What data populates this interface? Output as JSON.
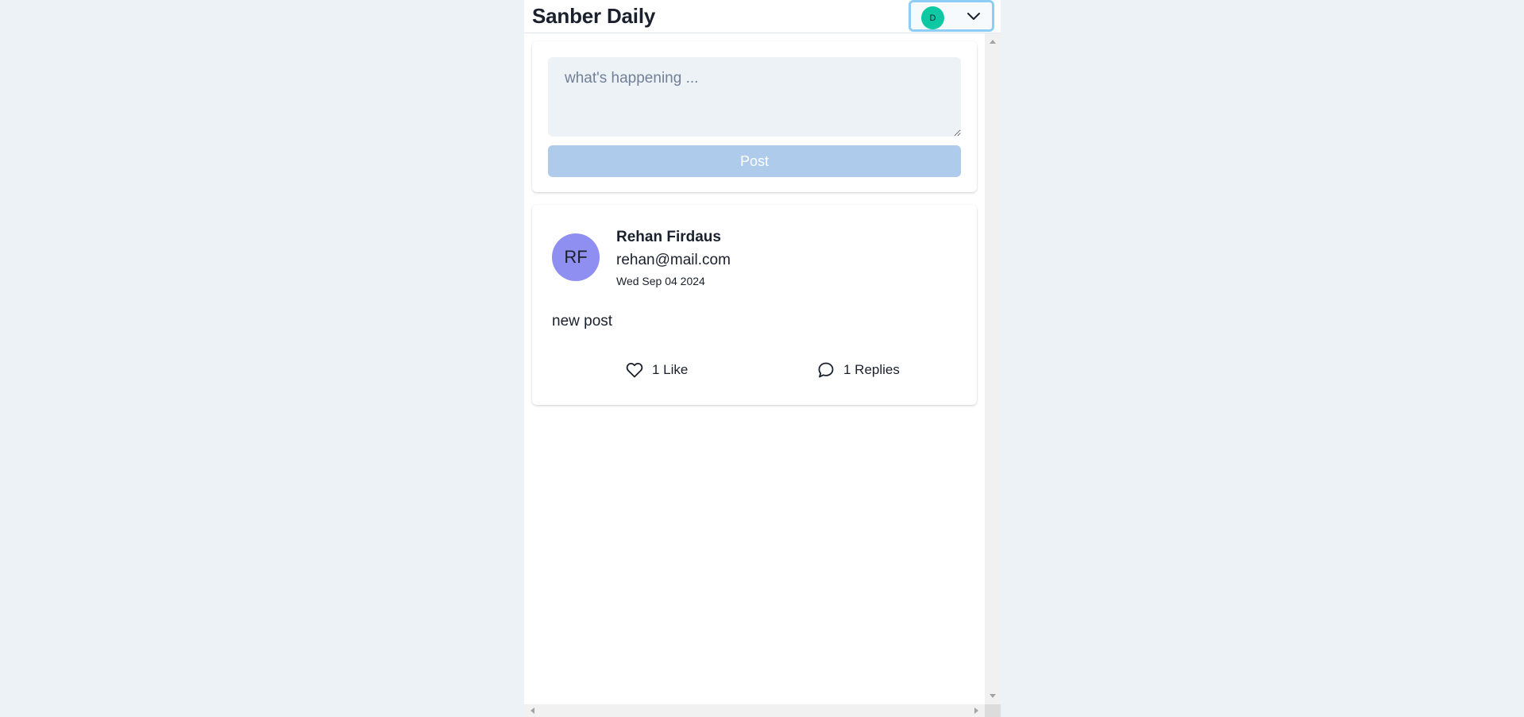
{
  "header": {
    "brand": "Sanber Daily",
    "user_initial": "D"
  },
  "composer": {
    "placeholder": "what's happening ...",
    "value": "",
    "post_label": "Post"
  },
  "post": {
    "avatar_initials": "RF",
    "author_name": "Rehan Firdaus",
    "author_email": "rehan@mail.com",
    "date": "Wed Sep 04 2024",
    "content": "new post",
    "like_label": "1 Like",
    "reply_label": "1 Replies"
  },
  "icons": {
    "chevron": "chevron-down-icon",
    "like": "heart-icon",
    "reply": "comment-icon"
  },
  "colors": {
    "page_bg": "#edf2f7",
    "user_avatar": "#0cc9a3",
    "post_avatar": "#8e8ff0",
    "post_button": "#aecbeb",
    "focus_ring": "#90cdf4"
  }
}
